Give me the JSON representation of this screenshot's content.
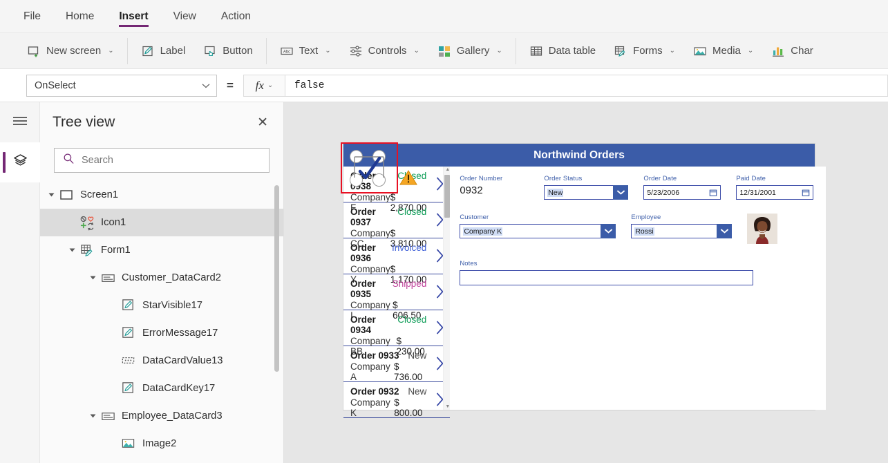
{
  "menubar": {
    "items": [
      {
        "label": "File",
        "active": false
      },
      {
        "label": "Home",
        "active": false
      },
      {
        "label": "Insert",
        "active": true
      },
      {
        "label": "View",
        "active": false
      },
      {
        "label": "Action",
        "active": false
      }
    ]
  },
  "ribbon": {
    "items": [
      {
        "label": "New screen",
        "icon": "new-screen-icon",
        "caret": "⌄"
      },
      {
        "label": "Label",
        "icon": "label-icon",
        "caret": ""
      },
      {
        "label": "Button",
        "icon": "button-icon",
        "caret": ""
      },
      {
        "label": "Text",
        "icon": "text-icon",
        "caret": "⌄"
      },
      {
        "label": "Controls",
        "icon": "controls-icon",
        "caret": "⌄"
      },
      {
        "label": "Gallery",
        "icon": "gallery-icon",
        "caret": "⌄"
      },
      {
        "label": "Data table",
        "icon": "data-table-icon",
        "caret": ""
      },
      {
        "label": "Forms",
        "icon": "forms-icon",
        "caret": "⌄"
      },
      {
        "label": "Media",
        "icon": "media-icon",
        "caret": "⌄"
      },
      {
        "label": "Char",
        "icon": "charts-icon",
        "caret": ""
      }
    ]
  },
  "formula_bar": {
    "property": "OnSelect",
    "equals": "=",
    "fx_label": "fx",
    "fx_caret": "⌄",
    "value": "false"
  },
  "rail": {
    "hamburger": "hamburger-icon",
    "items": [
      {
        "icon": "tree-view-layers-icon",
        "active": true
      }
    ]
  },
  "tree": {
    "title": "Tree view",
    "close": "✕",
    "search_placeholder": "Search",
    "search_value": "",
    "items": [
      {
        "label": "Screen1",
        "indent": 0,
        "expandable": true,
        "icon": "screen-icon",
        "selected": false
      },
      {
        "label": "Icon1",
        "indent": 1,
        "expandable": false,
        "icon": "icons-icon",
        "selected": true
      },
      {
        "label": "Form1",
        "indent": 1,
        "expandable": true,
        "icon": "form-edit-icon",
        "selected": false
      },
      {
        "label": "Customer_DataCard2",
        "indent": 2,
        "expandable": true,
        "icon": "datacard-icon",
        "selected": false
      },
      {
        "label": "StarVisible17",
        "indent": 3,
        "expandable": false,
        "icon": "label-edit-icon",
        "selected": false
      },
      {
        "label": "ErrorMessage17",
        "indent": 3,
        "expandable": false,
        "icon": "label-edit-icon",
        "selected": false
      },
      {
        "label": "DataCardValue13",
        "indent": 3,
        "expandable": false,
        "icon": "dropdown-value-icon",
        "selected": false
      },
      {
        "label": "DataCardKey17",
        "indent": 3,
        "expandable": false,
        "icon": "label-edit-icon",
        "selected": false
      },
      {
        "label": "Employee_DataCard3",
        "indent": 2,
        "expandable": true,
        "icon": "datacard-icon",
        "selected": false
      },
      {
        "label": "Image2",
        "indent": 3,
        "expandable": false,
        "icon": "image-icon",
        "selected": false
      }
    ]
  },
  "app": {
    "header_title": "Northwind Orders",
    "gallery": {
      "items": [
        {
          "order": "Order 0938",
          "company": "Company F",
          "status": "Closed",
          "status_color": "#0f9d58",
          "amount": "$ 2,870.00"
        },
        {
          "order": "Order 0937",
          "company": "Company CC",
          "status": "Closed",
          "status_color": "#0f9d58",
          "amount": "$ 3,810.00"
        },
        {
          "order": "Order 0936",
          "company": "Company Y",
          "status": "Invoiced",
          "status_color": "#4262d8",
          "amount": "$ 1,170.00"
        },
        {
          "order": "Order 0935",
          "company": "Company I",
          "status": "Shipped",
          "status_color": "#c0429b",
          "amount": "$ 606.50"
        },
        {
          "order": "Order 0934",
          "company": "Company BB",
          "status": "Closed",
          "status_color": "#0f9d58",
          "amount": "$ 230.00"
        },
        {
          "order": "Order 0933",
          "company": "Company A",
          "status": "New",
          "status_color": "#4a4a4a",
          "amount": "$ 736.00"
        },
        {
          "order": "Order 0932",
          "company": "Company K",
          "status": "New",
          "status_color": "#4a4a4a",
          "amount": "$ 800.00"
        }
      ]
    },
    "detail": {
      "order_number_label": "Order Number",
      "order_number_value": "0932",
      "order_status_label": "Order Status",
      "order_status_value": "New",
      "order_date_label": "Order Date",
      "order_date_value": "5/23/2006",
      "paid_date_label": "Paid Date",
      "paid_date_value": "12/31/2001",
      "customer_label": "Customer",
      "customer_value": "Company K",
      "employee_label": "Employee",
      "employee_value": "Rossi",
      "notes_label": "Notes",
      "notes_value": ""
    }
  },
  "selection": {
    "element": "Icon1",
    "overlay_color": "#e81123",
    "warning": "warning-icon"
  }
}
